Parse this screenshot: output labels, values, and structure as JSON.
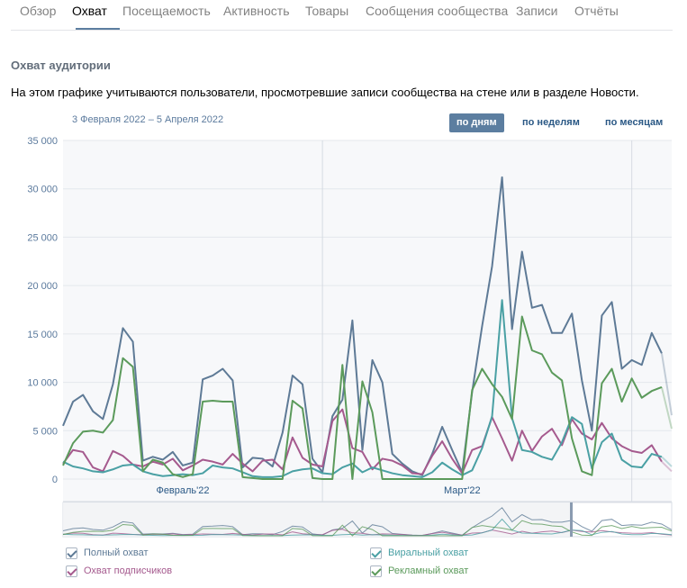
{
  "tabs": [
    {
      "label": "Обзор",
      "active": false
    },
    {
      "label": "Охват",
      "active": true
    },
    {
      "label": "Посещаемость",
      "active": false
    },
    {
      "label": "Активность",
      "active": false
    },
    {
      "label": "Товары",
      "active": false
    },
    {
      "label": "Сообщения сообщества",
      "active": false
    },
    {
      "label": "Записи",
      "active": false
    },
    {
      "label": "Отчёты",
      "active": false
    }
  ],
  "section": {
    "title": "Охват аудитории",
    "description": "На этом графике учитываются пользователи, просмотревшие записи сообщества на стене или в разделе Новости."
  },
  "date_range": "3 Февраля 2022 – 5 Апреля 2022",
  "period_buttons": [
    {
      "label": "по дням",
      "active": true
    },
    {
      "label": "по неделям",
      "active": false
    },
    {
      "label": "по месяцам",
      "active": false
    }
  ],
  "chart_data": {
    "type": "line",
    "x_start": "2022-02-03",
    "x_end": "2022-04-05",
    "ylim": [
      0,
      35000
    ],
    "y_ticks": [
      "0",
      "5 000",
      "10 000",
      "15 000",
      "20 000",
      "25 000",
      "30 000",
      "35 000"
    ],
    "y_tick_values": [
      0,
      5000,
      10000,
      15000,
      20000,
      25000,
      30000,
      35000
    ],
    "x_tick_labels": [
      "Февраль'22",
      "Март'22"
    ],
    "x_tick_dates": [
      "2022-02-15",
      "2022-03-15"
    ],
    "month_boundaries": [
      "2022-03-01",
      "2022-04-01"
    ],
    "grid": true,
    "legend_position": "bottom",
    "series": [
      {
        "name": "Полный охват",
        "color": "#5e7a96",
        "values": [
          5500,
          8000,
          8700,
          7000,
          6200,
          9800,
          15600,
          14200,
          1900,
          2300,
          2000,
          2800,
          1400,
          1700,
          10300,
          10700,
          11400,
          10200,
          1200,
          2200,
          2100,
          1300,
          4800,
          10700,
          9800,
          2100,
          700,
          6500,
          8200,
          16400,
          3000,
          12300,
          10000,
          2600,
          1600,
          800,
          400,
          2600,
          5400,
          3000,
          700,
          9000,
          15800,
          22000,
          31200,
          15500,
          23500,
          17700,
          18000,
          15100,
          15100,
          17100,
          10200,
          5000,
          16900,
          18300,
          11400,
          12300,
          11800,
          15100,
          13000,
          6600
        ]
      },
      {
        "name": "Охват подписчиков",
        "color": "#a55a8e",
        "values": [
          1600,
          3000,
          2800,
          1200,
          800,
          2900,
          2400,
          1500,
          1300,
          1800,
          1500,
          2100,
          900,
          1400,
          2000,
          1800,
          1500,
          2600,
          1600,
          800,
          1900,
          2000,
          1000,
          4300,
          2200,
          1500,
          1300,
          6000,
          7200,
          3200,
          2800,
          1000,
          2100,
          1900,
          1400,
          600,
          500,
          2400,
          3900,
          2100,
          600,
          3000,
          3400,
          6400,
          4200,
          1900,
          5000,
          2900,
          4400,
          5200,
          3500,
          6200,
          4700,
          4100,
          5800,
          4200,
          3400,
          2900,
          2700,
          3500,
          1800,
          800
        ]
      },
      {
        "name": "Виральный охват",
        "color": "#4aa0a4",
        "values": [
          1800,
          1300,
          1100,
          800,
          700,
          1000,
          1400,
          1500,
          800,
          500,
          300,
          400,
          500,
          400,
          600,
          1400,
          1200,
          1100,
          700,
          300,
          200,
          200,
          300,
          800,
          1000,
          1100,
          600,
          500,
          1200,
          1600,
          700,
          1200,
          900,
          600,
          400,
          300,
          200,
          700,
          1700,
          1000,
          400,
          900,
          3200,
          6500,
          18500,
          6300,
          3000,
          2800,
          2300,
          2000,
          3800,
          6400,
          5700,
          1100,
          3800,
          4700,
          2000,
          1300,
          1200,
          2600,
          2300,
          1300
        ]
      },
      {
        "name": "Рекламный охват",
        "color": "#5b9a5b",
        "values": [
          1400,
          3700,
          4900,
          5000,
          4800,
          6100,
          12500,
          11600,
          800,
          2000,
          1700,
          500,
          200,
          500,
          8000,
          8100,
          8000,
          8000,
          200,
          100,
          0,
          0,
          0,
          8100,
          7300,
          100,
          0,
          0,
          11800,
          0,
          10100,
          6900,
          0,
          0,
          0,
          0,
          0,
          0,
          0,
          0,
          0,
          9200,
          11400,
          9800,
          8500,
          6200,
          16800,
          13300,
          12900,
          11000,
          10200,
          4200,
          800,
          400,
          9900,
          11400,
          8000,
          10400,
          8400,
          9100,
          9500,
          5200
        ]
      }
    ]
  },
  "legend": [
    {
      "label": "Полный охват",
      "color": "#5e7a96"
    },
    {
      "label": "Виральный охват",
      "color": "#4aa0a4"
    },
    {
      "label": "Охват подписчиков",
      "color": "#a55a8e"
    },
    {
      "label": "Рекламный охват",
      "color": "#5b9a5b"
    }
  ]
}
